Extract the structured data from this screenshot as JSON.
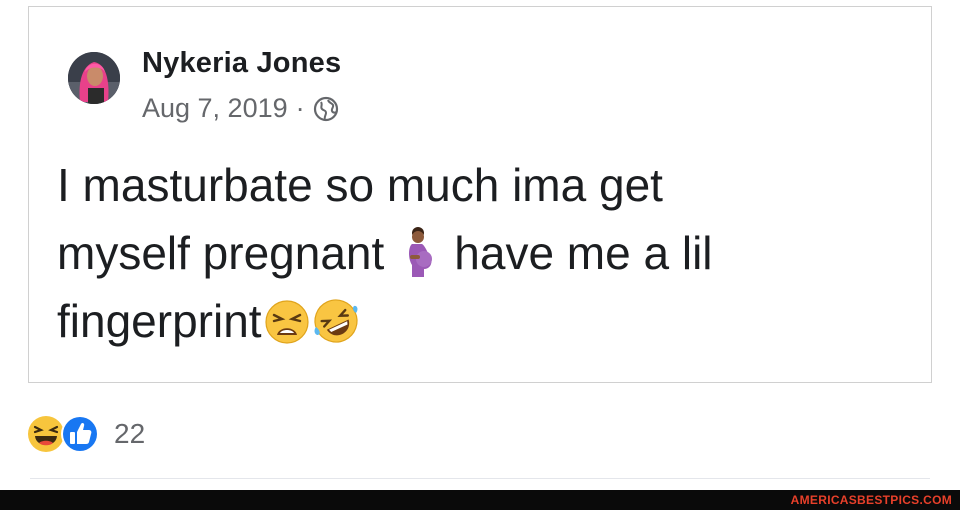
{
  "post": {
    "author": "Nykeria Jones",
    "date": "Aug 7, 2019",
    "separator": "·",
    "privacy_icon": "globe-icon",
    "avatar_icon": "profile-photo",
    "text_lines": [
      "I masturbate so much ima get",
      "myself pregnant",
      "have me a lil",
      "fingerprint"
    ],
    "emojis": [
      "pregnant-woman-emoji",
      "weary-face-emoji",
      "rolling-on-floor-laughing-emoji"
    ]
  },
  "reactions": {
    "icons": [
      "haha-reaction-icon",
      "like-reaction-icon"
    ],
    "count": "22"
  },
  "footer": {
    "watermark": "AMERICASBESTPICS.COM"
  },
  "colors": {
    "like_blue": "#1877f2",
    "haha_yellow": "#f7c53d",
    "text_primary": "#1c1e21",
    "text_secondary": "#65676b",
    "watermark_red": "#e8402a",
    "footer_bg": "#0a0a0a"
  }
}
